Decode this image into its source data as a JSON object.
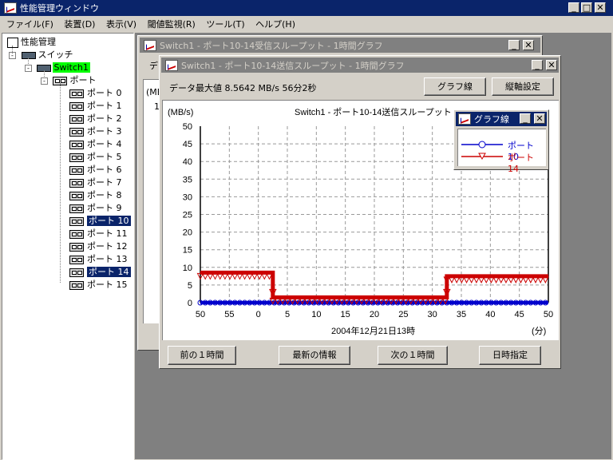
{
  "app": {
    "title": "性能管理ウィンドウ"
  },
  "menu": [
    "ファイル(F)",
    "装置(D)",
    "表示(V)",
    "閾値監視(R)",
    "ツール(T)",
    "ヘルプ(H)"
  ],
  "tree": {
    "root": "性能管理",
    "switch_group": "スイッチ",
    "switch1": "Switch1",
    "port_group": "ポート",
    "ports": [
      "ポート 0",
      "ポート 1",
      "ポート 2",
      "ポート 3",
      "ポート 4",
      "ポート 5",
      "ポート 6",
      "ポート 7",
      "ポート 8",
      "ポート 9",
      "ポート 10",
      "ポート 11",
      "ポート 12",
      "ポート 13",
      "ポート 14",
      "ポート 15"
    ],
    "selected_ports": [
      "ポート 10",
      "ポート 14"
    ]
  },
  "back_window": {
    "title": "Switch1 - ポート10-14受信スループット - 1時間グラフ",
    "partial_label": "デ",
    "partial_mb": "(MB",
    "partial_1": "1"
  },
  "graph_window": {
    "title": "Switch1 - ポート10-14送信スループット - 1時間グラフ",
    "data_max": "データ最大値  8.5642 MB/s  56分2秒",
    "btn_graph_line": "グラフ線",
    "btn_vertical": "縦軸設定",
    "btn_prev": "前の１時間",
    "btn_latest": "最新の情報",
    "btn_next": "次の１時間",
    "btn_datetime": "日時指定"
  },
  "legend_window": {
    "title": "グラフ線"
  },
  "colors": {
    "port10": "#0000cc",
    "port14": "#cc0000",
    "selection": "#0a246a",
    "switch_highlight": "#00ff00",
    "title_active": "#0a246a",
    "title_inactive": "#808080"
  },
  "chart_data": {
    "type": "line",
    "title": "Switch1 - ポート10-14送信スループット",
    "ylabel": "(MB/s)",
    "xlabel": "2004年12月21日13時",
    "xunit": "(分)",
    "ylim": [
      0,
      50
    ],
    "yticks": [
      0,
      5,
      10,
      15,
      20,
      25,
      30,
      35,
      40,
      45,
      50
    ],
    "x_ticks": [
      "50",
      "55",
      "0",
      "5",
      "10",
      "15",
      "20",
      "25",
      "30",
      "35",
      "40",
      "45",
      "50"
    ],
    "grid": true,
    "legend_position": "top-right",
    "series": [
      {
        "name": "ポート 10",
        "color": "#0000cc",
        "marker": "circle",
        "points": [
          [
            0,
            0
          ],
          [
            60,
            0
          ]
        ]
      },
      {
        "name": "ポート 14",
        "color": "#cc0000",
        "marker": "triangle-down",
        "points": [
          [
            0,
            8.5
          ],
          [
            12.5,
            8.5
          ],
          [
            12.5,
            1.5
          ],
          [
            42.5,
            1.5
          ],
          [
            42.5,
            7.5
          ],
          [
            60,
            7.5
          ]
        ]
      }
    ]
  }
}
